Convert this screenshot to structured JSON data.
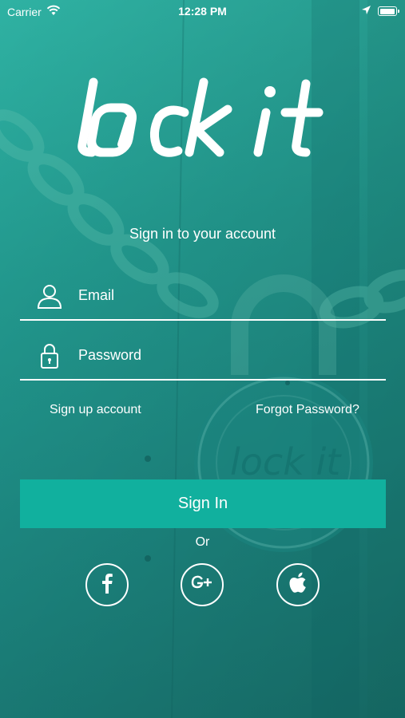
{
  "status_bar": {
    "carrier": "Carrier",
    "time": "12:28 PM"
  },
  "brand": {
    "logo_text": "lock it",
    "accent": "#11b09e",
    "background": "#239d92"
  },
  "subtitle": "Sign in to your account",
  "form": {
    "email": {
      "placeholder": "Email",
      "value": "",
      "icon": "user-icon"
    },
    "password": {
      "placeholder": "Password",
      "value": "",
      "icon": "lock-icon"
    }
  },
  "links": {
    "sign_up": "Sign up account",
    "forgot": "Forgot Password?"
  },
  "sign_in_label": "Sign In",
  "or_label": "Or",
  "social": [
    {
      "name": "facebook-icon"
    },
    {
      "name": "google-plus-icon"
    },
    {
      "name": "apple-icon"
    }
  ]
}
